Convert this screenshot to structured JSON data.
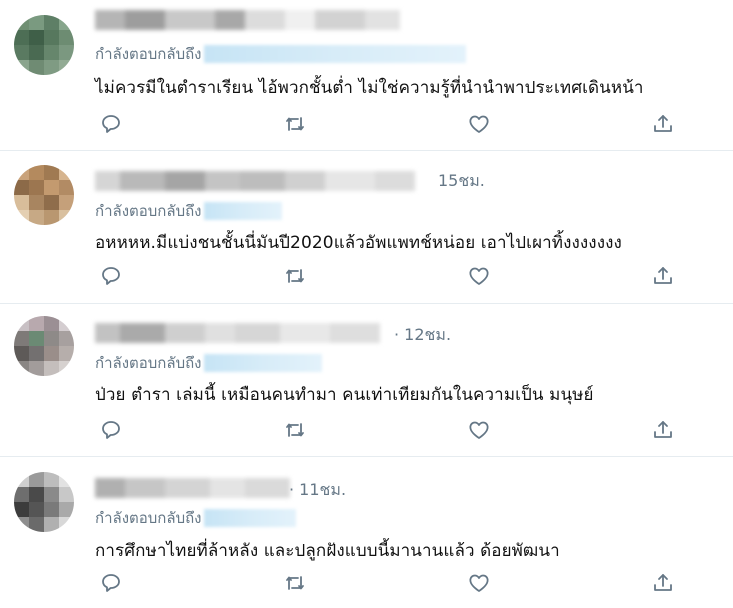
{
  "reply_prefix": "กำลังตอบกลับถึง",
  "tweets": [
    {
      "time": "",
      "text": "ไม่ควรมีในตำราเรียน ไอ้พวกชั้นต่ำ ไม่ใช่ความรู้ที่นำนำพาประเทศเดินหน้า"
    },
    {
      "time": "15ชม.",
      "text": "อหหหห.มีแบ่งชนชั้นนี่มันปี2020แล้วอัพแพทช์หน่อย เอาไปเผาทิ้งงงงงงง"
    },
    {
      "time": "· 12ชม.",
      "text": "ป่วย ตำรา เล่มนี้  เหมือนคนทำมา  คนเท่าเทียมกันในความเป็น มนุษย์"
    },
    {
      "time": "· 11ชม.",
      "text": "การศึกษาไทยที่ล้าหลัง และปลูกฝังแบบนี้มานานแล้ว ด้อยพัฒนา"
    }
  ],
  "icons": {
    "reply": "reply-icon",
    "retweet": "retweet-icon",
    "like": "heart-icon",
    "share": "share-icon"
  },
  "colors": {
    "secondary_text": "#657786",
    "divider": "#e6ecf0",
    "handle_highlight": "#c6e4f5"
  }
}
